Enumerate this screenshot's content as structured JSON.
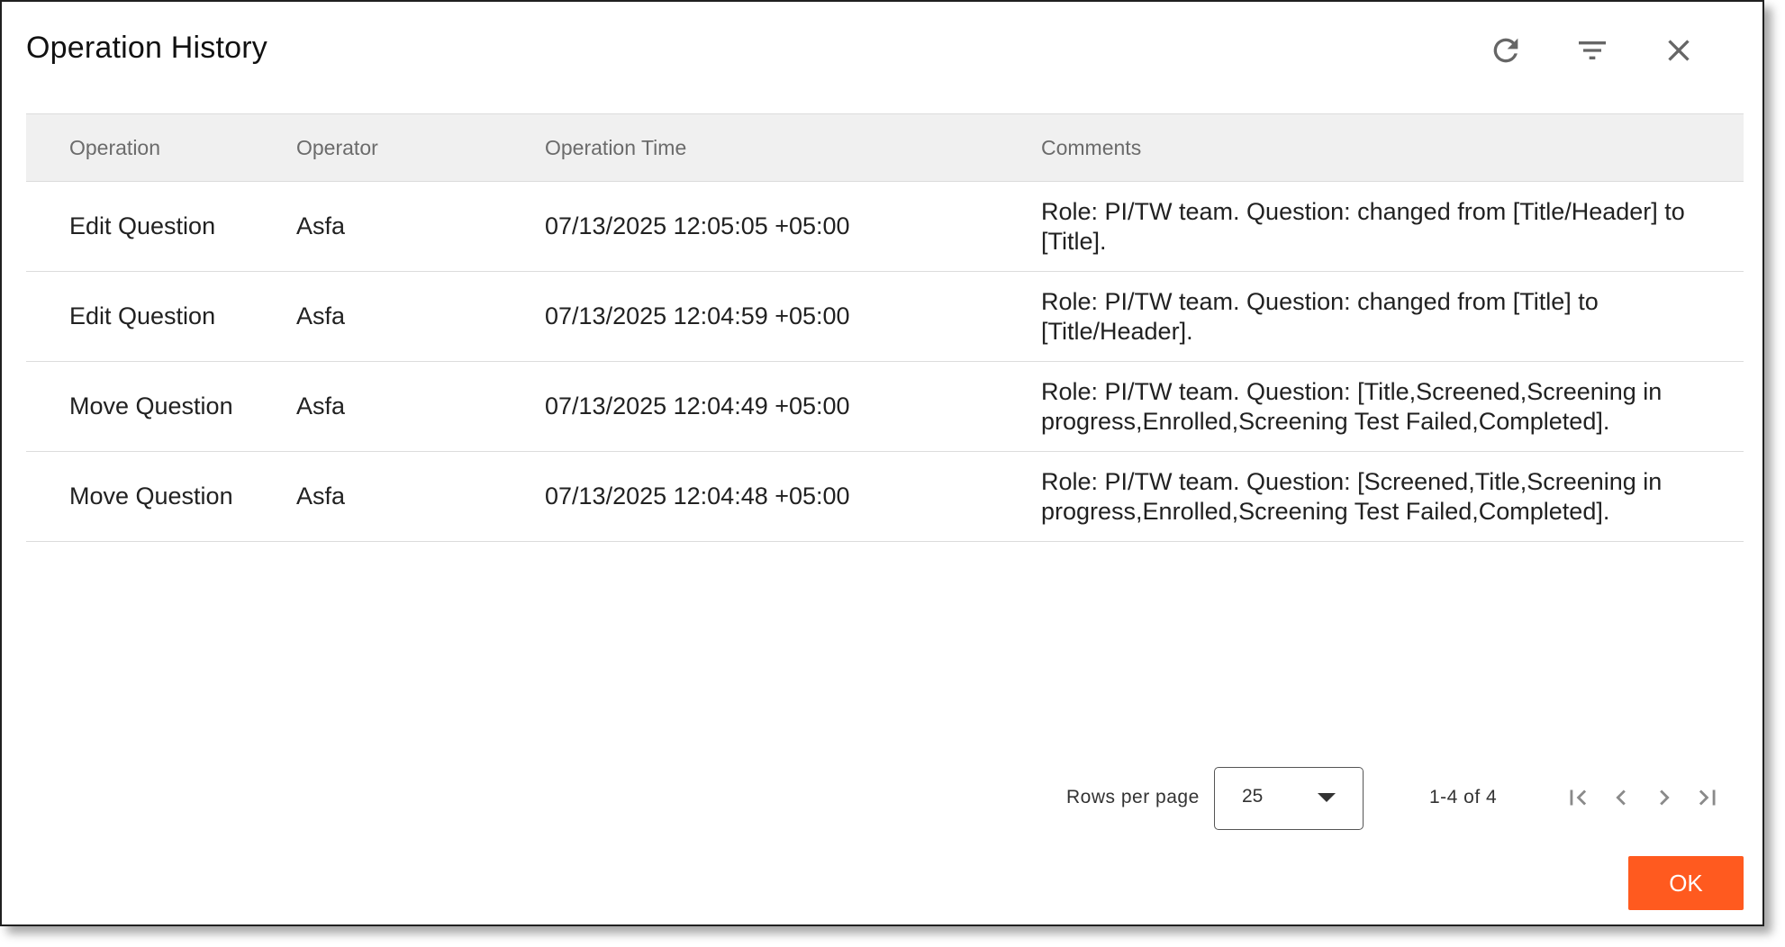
{
  "dialog": {
    "title": "Operation History"
  },
  "icons": {
    "refresh": "refresh-icon",
    "filter": "filter-icon",
    "close": "close-icon"
  },
  "table": {
    "headers": [
      "Operation",
      "Operator",
      "Operation Time",
      "Comments"
    ],
    "rows": [
      [
        "Edit Question",
        "Asfa",
        "07/13/2025 12:05:05 +05:00",
        "Role: PI/TW team. Question: changed from [Title/Header] to [Title]."
      ],
      [
        "Edit Question",
        "Asfa",
        "07/13/2025 12:04:59 +05:00",
        "Role: PI/TW team. Question: changed from [Title] to [Title/Header]."
      ],
      [
        "Move Question",
        "Asfa",
        "07/13/2025 12:04:49 +05:00",
        "Role: PI/TW team. Question: [Title,Screened,Screening in progress,Enrolled,Screening Test Failed,Completed]."
      ],
      [
        "Move Question",
        "Asfa",
        "07/13/2025 12:04:48 +05:00",
        "Role: PI/TW team. Question: [Screened,Title,Screening in progress,Enrolled,Screening Test Failed,Completed]."
      ]
    ]
  },
  "pagination": {
    "rows_per_page_label": "Rows per page",
    "rows_per_page_value": "25",
    "range_text": "1-4 of 4"
  },
  "actions": {
    "ok_label": "OK"
  },
  "colors": {
    "accent": "#ff5a1f",
    "header_bg": "#f0f0f0"
  }
}
